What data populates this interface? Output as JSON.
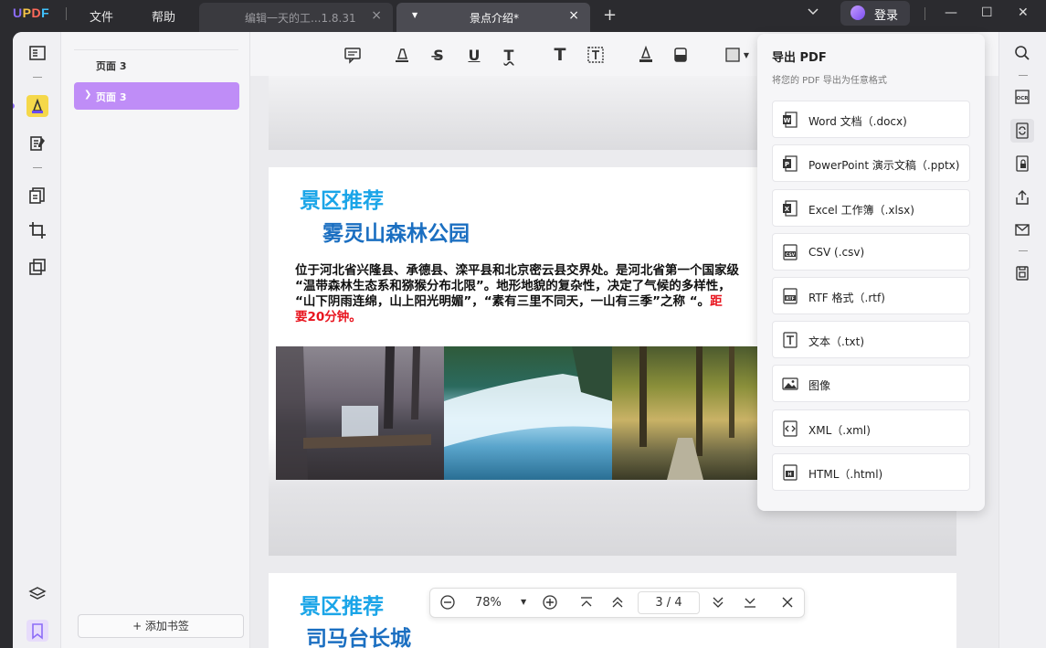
{
  "app": {
    "logo": "UPDF"
  },
  "menu": {
    "file": "文件",
    "help": "帮助"
  },
  "tabs": [
    {
      "label": "编辑一天的工...1.8.31",
      "close": "×"
    },
    {
      "label": "景点介绍*",
      "close": "×"
    }
  ],
  "titlebar": {
    "add_tab": "+",
    "login": "登录",
    "minimize": "—",
    "maximize": "☐",
    "close": "✕",
    "chevron": "⌄"
  },
  "bookmarks": {
    "items": [
      {
        "label": "页面 3"
      },
      {
        "label": "页面 3",
        "selected": true
      }
    ],
    "add_label": "+ 添加书签"
  },
  "document": {
    "section1": {
      "heading": "景区推荐",
      "subheading": "雾灵山森林公园"
    },
    "body_lines": [
      "位于河北省兴隆县、承德县、滦平县和北京密云县交界处。是河北省第一个国家级",
      "“温带森林生态系和猕猴分布北限”。地形地貌的复杂性，决定了气候的多样性，",
      "“山下阴雨连绵，山上阳光明媚”，“素有三里不同天，一山有三季”之称 “。"
    ],
    "body_red_inline": "距",
    "body_red_line": "要20分钟。",
    "section2": {
      "heading": "景区推荐",
      "subheading": "司马台长城"
    }
  },
  "zoom": {
    "level": "78%",
    "current_page": "3",
    "separator": "/",
    "total_pages": "4"
  },
  "export_panel": {
    "title": "导出 PDF",
    "subtitle": "将您的 PDF 导出为任意格式",
    "items": [
      {
        "label": "Word 文档（.docx)",
        "icon": "word-icon"
      },
      {
        "label": "PowerPoint 演示文稿（.pptx)",
        "icon": "powerpoint-icon"
      },
      {
        "label": "Excel 工作簿（.xlsx)",
        "icon": "excel-icon"
      },
      {
        "label": "CSV (.csv)",
        "icon": "csv-icon"
      },
      {
        "label": "RTF 格式（.rtf)",
        "icon": "rtf-icon"
      },
      {
        "label": "文本（.txt)",
        "icon": "text-icon"
      },
      {
        "label": "图像",
        "icon": "image-icon"
      },
      {
        "label": "XML（.xml)",
        "icon": "xml-icon"
      },
      {
        "label": "HTML（.html)",
        "icon": "html-icon"
      }
    ]
  },
  "colors": {
    "accent": "#8c6cf7",
    "bookmark_selected": "#bf8df7",
    "heading_blue": "#1aa5e8",
    "subheading_blue": "#1b6fc1",
    "red_text": "#e8141e"
  }
}
